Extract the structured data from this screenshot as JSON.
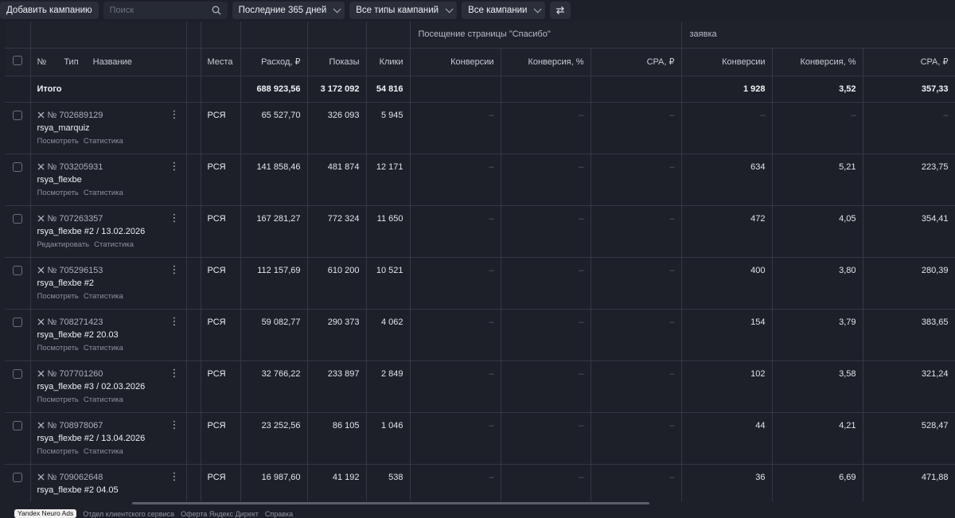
{
  "toolbar": {
    "add_campaign": "Добавить кампанию",
    "search_placeholder": "Поиск",
    "period": "Последние 365 дней",
    "campaign_types": "Все типы кампаний",
    "campaigns_filter": "Все кампании"
  },
  "groups": {
    "thank_you": "Посещение страницы \"Спасибо\"",
    "lead": "заявка"
  },
  "columns": {
    "number": "№",
    "type": "Тип",
    "name": "Название",
    "places": "Места",
    "spend": "Расход, ₽",
    "impressions": "Показы",
    "clicks": "Клики",
    "conversions": "Конверсии",
    "conversion_rate": "Конверсия, %",
    "cpa": "CPA, ₽"
  },
  "total": {
    "label": "Итого",
    "spend": "688 923,56",
    "impressions": "3 172 092",
    "clicks": "54 816",
    "lead_conv": "1 928",
    "lead_rate": "3,52",
    "lead_cpa": "357,33"
  },
  "dash": "–",
  "campaigns": [
    {
      "id": "№ 702689129",
      "name": "rsya_marquiz",
      "link1": "Посмотреть",
      "link2": "Статистика",
      "place": "РСЯ",
      "spend": "65 527,70",
      "impressions": "326 093",
      "clicks": "5 945",
      "lead_conv": "–",
      "lead_rate": "–",
      "lead_cpa": "–"
    },
    {
      "id": "№ 703205931",
      "name": "rsya_flexbe",
      "link1": "Посмотреть",
      "link2": "Статистика",
      "place": "РСЯ",
      "spend": "141 858,46",
      "impressions": "481 874",
      "clicks": "12 171",
      "lead_conv": "634",
      "lead_rate": "5,21",
      "lead_cpa": "223,75"
    },
    {
      "id": "№ 707263357",
      "name": "rsya_flexbe #2 / 13.02.2026",
      "link1": "Редактировать",
      "link2": "Статистика",
      "place": "РСЯ",
      "spend": "167 281,27",
      "impressions": "772 324",
      "clicks": "11 650",
      "lead_conv": "472",
      "lead_rate": "4,05",
      "lead_cpa": "354,41"
    },
    {
      "id": "№ 705296153",
      "name": "rsya_flexbe #2",
      "link1": "Посмотреть",
      "link2": "Статистика",
      "place": "РСЯ",
      "spend": "112 157,69",
      "impressions": "610 200",
      "clicks": "10 521",
      "lead_conv": "400",
      "lead_rate": "3,80",
      "lead_cpa": "280,39"
    },
    {
      "id": "№ 708271423",
      "name": "rsya_flexbe #2 20.03",
      "link1": "Посмотреть",
      "link2": "Статистика",
      "place": "РСЯ",
      "spend": "59 082,77",
      "impressions": "290 373",
      "clicks": "4 062",
      "lead_conv": "154",
      "lead_rate": "3,79",
      "lead_cpa": "383,65"
    },
    {
      "id": "№ 707701260",
      "name": "rsya_flexbe #3 / 02.03.2026",
      "link1": "Посмотреть",
      "link2": "Статистика",
      "place": "РСЯ",
      "spend": "32 766,22",
      "impressions": "233 897",
      "clicks": "2 849",
      "lead_conv": "102",
      "lead_rate": "3,58",
      "lead_cpa": "321,24"
    },
    {
      "id": "№ 708978067",
      "name": "rsya_flexbe #2 / 13.04.2026",
      "link1": "Посмотреть",
      "link2": "Статистика",
      "place": "РСЯ",
      "spend": "23 252,56",
      "impressions": "86 105",
      "clicks": "1 046",
      "lead_conv": "44",
      "lead_rate": "4,21",
      "lead_cpa": "528,47"
    },
    {
      "id": "№ 709062648",
      "name": "rsya_flexbe #2 04.05",
      "link1": "",
      "link2": "",
      "place": "РСЯ",
      "spend": "16 987,60",
      "impressions": "41 192",
      "clicks": "538",
      "lead_conv": "36",
      "lead_rate": "6,69",
      "lead_cpa": "471,88"
    }
  ],
  "footer": {
    "brand": "Yandex Neuro Ads",
    "links": [
      "Отдел клиентского сервиса",
      "Оферта Яндекс Директ",
      "Справка"
    ]
  }
}
